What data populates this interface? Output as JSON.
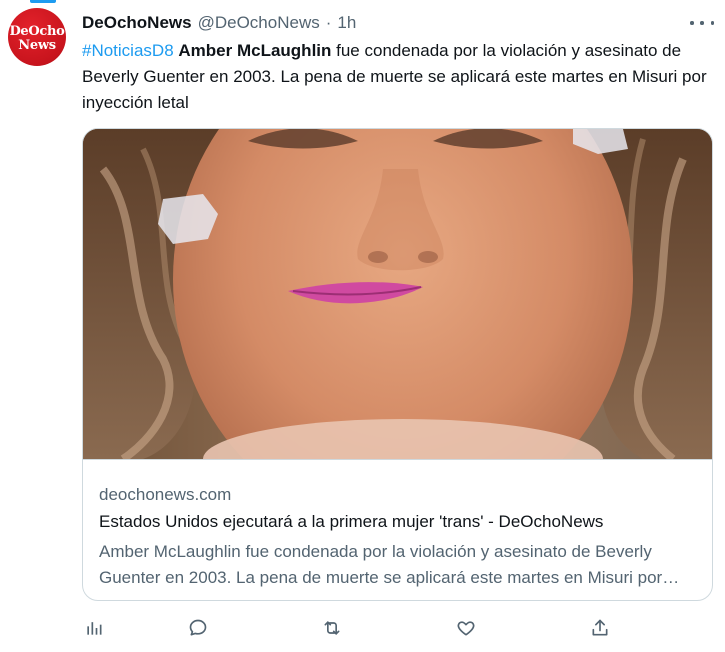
{
  "tweet": {
    "author_name": "DeOchoNews",
    "author_handle": "@DeOchoNews",
    "separator": "·",
    "timestamp": "1h",
    "avatar_text_line1": "DeOcho",
    "avatar_text_line2": "News",
    "hashtag": "#NoticiasD8",
    "bold_name": "Amber McLaughlin",
    "body_rest": " fue condenada por la violación y asesinato de Beverly Guenter en 2003. La pena de muerte se aplicará este martes en Misuri por inyección letal"
  },
  "card": {
    "domain": "deochonews.com",
    "title": "Estados Unidos ejecutará a la primera mujer 'trans' - DeOchoNews",
    "description": "Amber McLaughlin fue condenada por la violación y asesinato de Beverly Guenter en 2003. La pena de muerte se aplicará este martes en Misuri por inyección letal"
  },
  "actions": {
    "analytics_icon": "bar-chart-icon",
    "reply_icon": "speech-bubble-icon",
    "retweet_icon": "retweet-arrows-icon",
    "like_icon": "heart-icon",
    "share_icon": "share-upload-icon"
  },
  "colors": {
    "accent": "#1d9bf0",
    "text_primary": "#0f1419",
    "text_secondary": "#536471",
    "border": "#cfd9de",
    "avatar_red": "#c8141d"
  }
}
